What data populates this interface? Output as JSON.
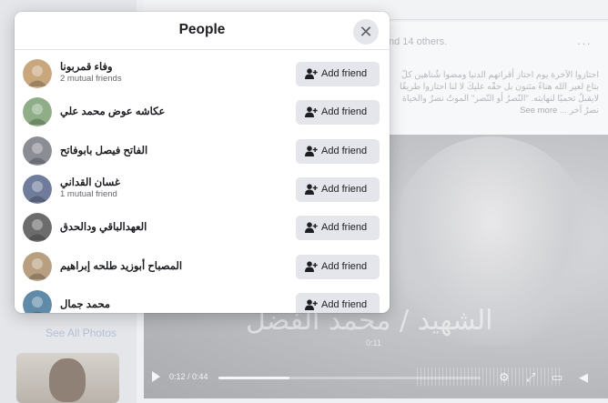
{
  "modal": {
    "title": "People",
    "close_icon": "close-icon"
  },
  "people": [
    {
      "name": "وفاء قمربونا",
      "mutual": "2 mutual friends",
      "button": "Add friend",
      "avatar_color": "#c9a77d"
    },
    {
      "name": "عكاشه عوض محمد علي",
      "mutual": "",
      "button": "Add friend",
      "avatar_color": "#8fae87"
    },
    {
      "name": "الفاتح فيصل بابوفاتح",
      "mutual": "",
      "button": "Add friend",
      "avatar_color": "#8b8d94"
    },
    {
      "name": "غسان القداني",
      "mutual": "1 mutual friend",
      "button": "Add friend",
      "avatar_color": "#6f7c9b"
    },
    {
      "name": "العهدالباقي ودالحدق",
      "mutual": "",
      "button": "Add friend",
      "avatar_color": "#6c6c6c"
    },
    {
      "name": "المصباح أبوزيد طلحه إبراهيم",
      "mutual": "",
      "button": "Add friend",
      "avatar_color": "#b89f80"
    },
    {
      "name": "محمد جمال",
      "mutual": "",
      "button": "Add friend",
      "avatar_color": "#5f8aa8"
    }
  ],
  "background": {
    "likes_text": "nd 14 others.",
    "caption": "احتازوا الآخرة يوم احتاز أقرانهم الدنيا ومضوا شُناهين كلّ بتاع لعير الله هناءً مثنون بل حقّه عليكَ لا لنا احتازوا طريقًا لايقبلُ تحميًا لنهايته. \"النّصرُ أو النّصر\" الموتُ نصرٌ والحياة نصرٌ آخر ...",
    "see_more": "See more",
    "video_title": "الشهيد / محمد الفضل",
    "video_sub": "0:11",
    "video_time": "0:12 / 0:44",
    "video_progress_percent": 27,
    "see_all_photos": "See All Photos"
  },
  "colors": {
    "accent": "#1c1e21",
    "button_bg": "#e4e6eb",
    "link": "#385898"
  }
}
